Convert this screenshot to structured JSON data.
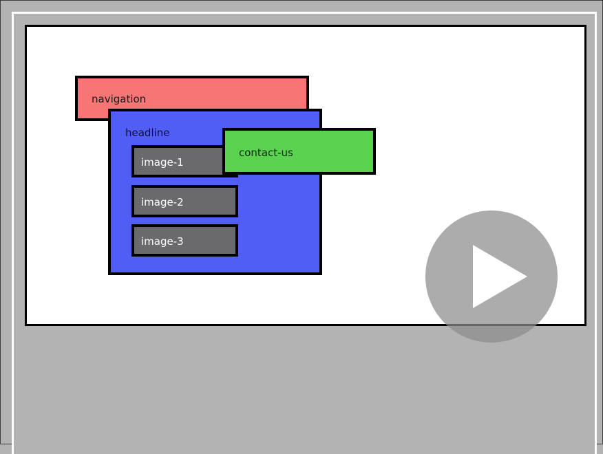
{
  "wireframe": {
    "navigation_label": "navigation",
    "headline_label": "headline",
    "images": [
      "image-1",
      "image-2",
      "image-3"
    ],
    "contact_label": "contact-us"
  },
  "colors": {
    "navigation": "#f77575",
    "headline": "#515ef5",
    "image": "#6a6a6c",
    "contact": "#5bd150"
  },
  "overlay": {
    "play_icon": "play-icon"
  }
}
